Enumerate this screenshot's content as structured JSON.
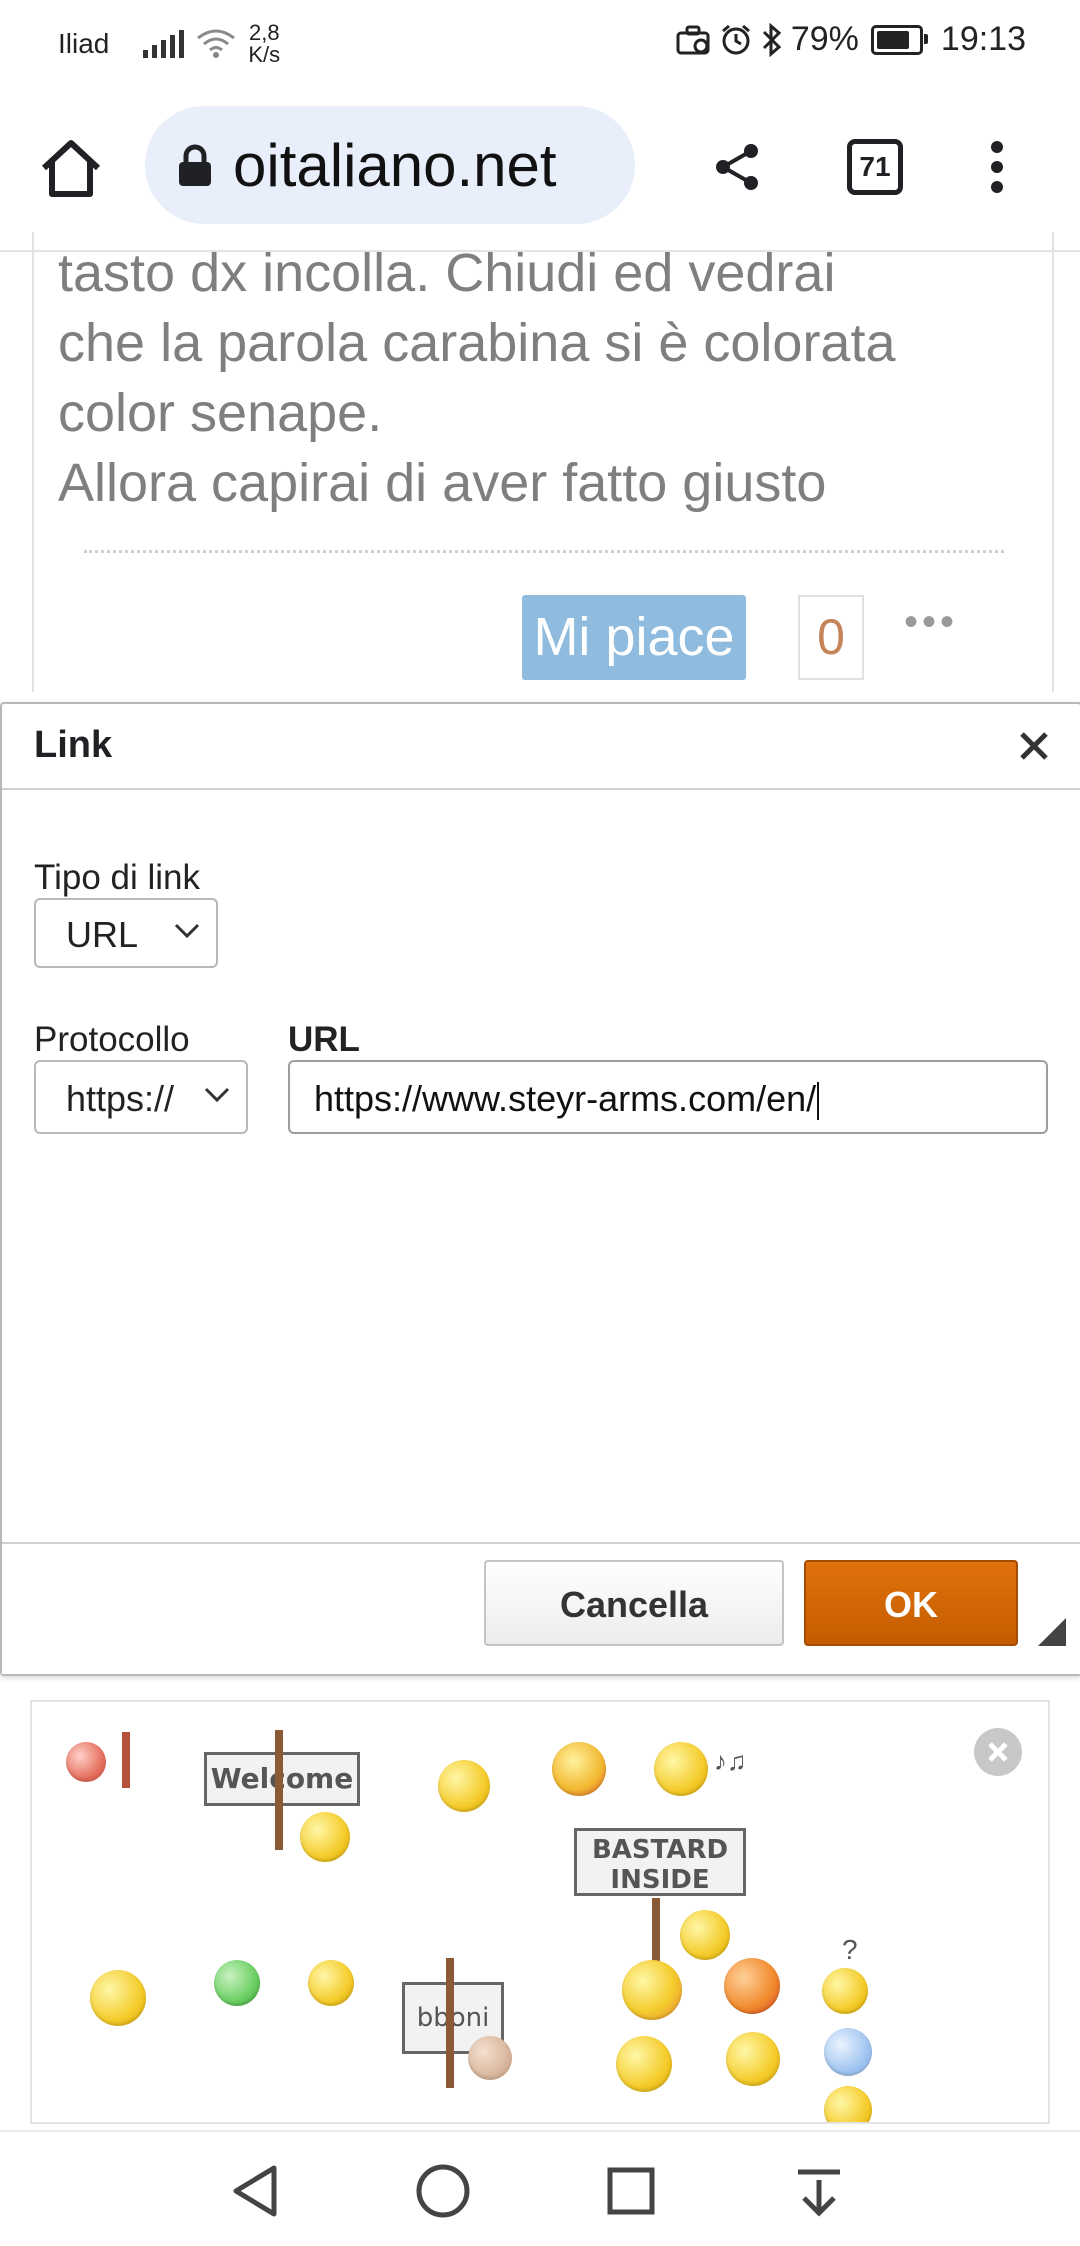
{
  "status_bar": {
    "carrier": "Iliad",
    "speed_value": "2,8",
    "speed_unit": "K/s",
    "battery": "79%",
    "battery_level": 0.79,
    "time": "19:13"
  },
  "browser": {
    "url_display": "oitaliano.net",
    "tab_count": "71"
  },
  "post": {
    "lines": [
      "tasto dx incolla. Chiudi ed vedrai",
      "che la parola carabina si è colorata",
      "color senape.",
      "Allora capirai di aver fatto giusto"
    ],
    "like_label": "Mi piace",
    "like_count": "0",
    "more": "•••"
  },
  "dialog": {
    "title": "Link",
    "link_type_label": "Tipo di link",
    "link_type_value": "URL",
    "protocol_label": "Protocollo",
    "protocol_value": "https://",
    "url_label": "URL",
    "url_value": "https://www.steyr-arms.com/en/",
    "cancel_label": "Cancella",
    "ok_label": "OK"
  },
  "smilies": {
    "welcome_sign": "Welcome",
    "bastard_sign_line1": "BASTARD",
    "bastard_sign_line2": "INSIDE",
    "bboni_sign": "bboni"
  },
  "colors": {
    "accent_ok": "#c45c00",
    "like_button": "#8fbcde",
    "omnibox": "#e8eefa"
  }
}
